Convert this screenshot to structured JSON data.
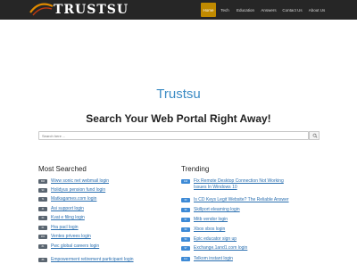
{
  "brand": {
    "name": "TRUSTSU",
    "accent": "#c08a00",
    "link_color": "#2a6fb0"
  },
  "nav": [
    {
      "label": "Home",
      "active": true
    },
    {
      "label": "Tech",
      "active": false
    },
    {
      "label": "Education",
      "active": false
    },
    {
      "label": "Answers",
      "active": false
    },
    {
      "label": "Contact Us",
      "active": false
    },
    {
      "label": "About Us",
      "active": false
    }
  ],
  "hero": {
    "title": "Trustsu",
    "subtitle": "Search Your Web Portal Right Away!"
  },
  "search": {
    "placeholder": "Search here ...",
    "icon": "search-icon"
  },
  "most_searched": {
    "title": "Most Searched",
    "items": [
      {
        "count": "393",
        "label": "Www sonic net webmail login"
      },
      {
        "count": "90",
        "label": "Holidyus pension fund login"
      },
      {
        "count": "71",
        "label": "Matkagames.com login"
      },
      {
        "count": "41",
        "label": "Asi support login"
      },
      {
        "count": "64",
        "label": "Kvat e filing login"
      },
      {
        "count": "61",
        "label": "Hra pacl login"
      },
      {
        "count": "161",
        "label": "Ventes privees login"
      },
      {
        "count": "81",
        "label": "Pwc global careers login"
      },
      {
        "count": "86",
        "label": "Empowerment retirement participant login"
      }
    ]
  },
  "trending": {
    "title": "Trending",
    "items": [
      {
        "count": "144",
        "label": "Fix Remote Desktop Connection Not Working",
        "label2": "Issues In Windows 10"
      },
      {
        "count": "60",
        "label": "Is CD Keys Legit Website? The Reliable Answer"
      },
      {
        "count": "96",
        "label": "Skillport elearning login"
      },
      {
        "count": "57",
        "label": "Mitb vendor login"
      },
      {
        "count": "60",
        "label": "Xbox xbos login"
      },
      {
        "count": "53",
        "label": "Epic educator sign up"
      },
      {
        "count": "97",
        "label": "Exchange.1and1.com login"
      },
      {
        "count": "111",
        "label": "Telkom instant login"
      }
    ]
  }
}
